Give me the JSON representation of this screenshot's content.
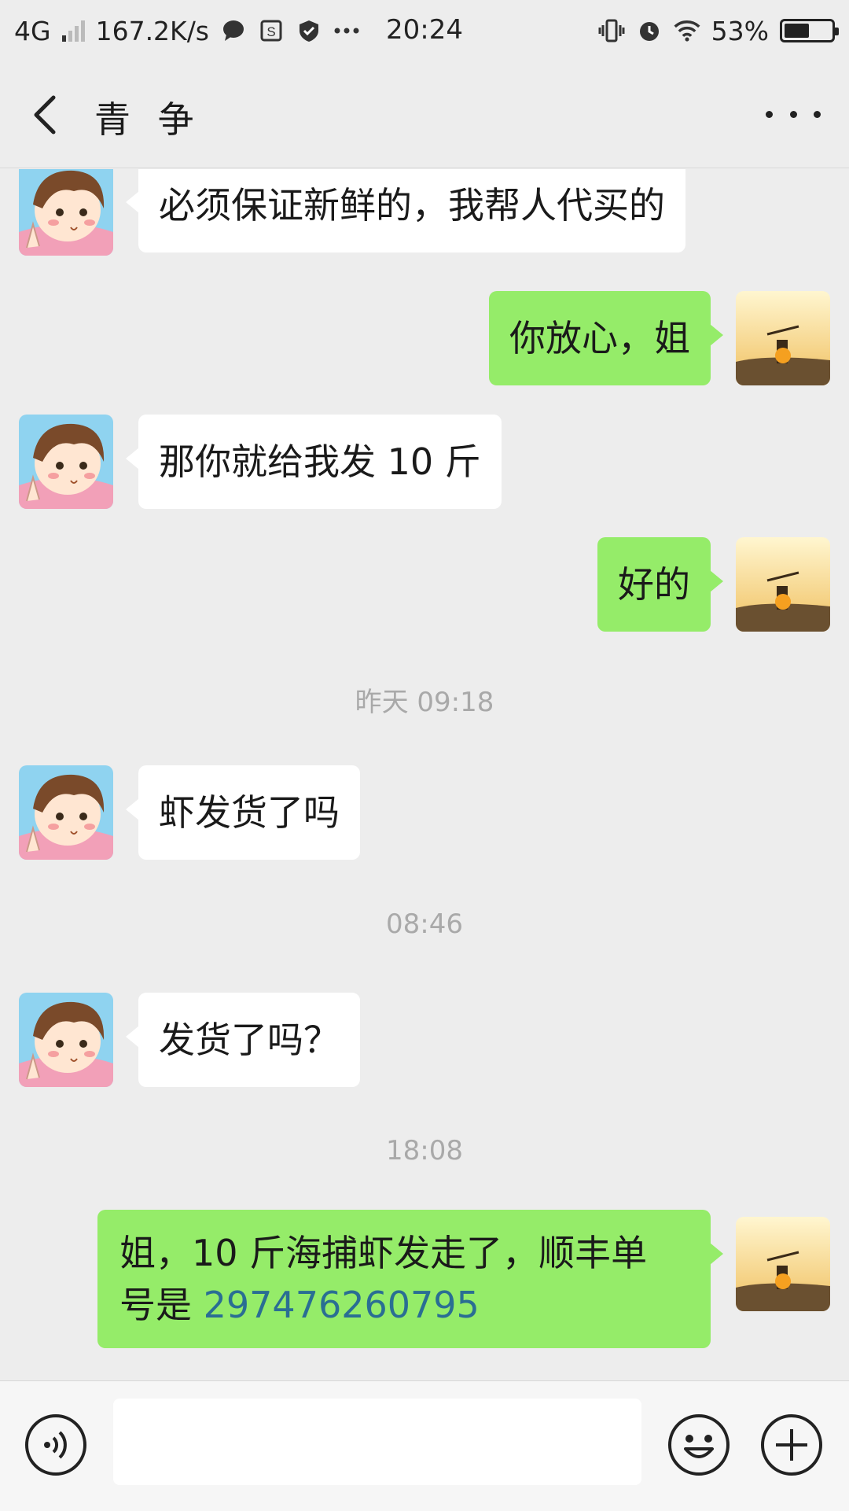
{
  "status_bar": {
    "network": "4G",
    "speed": "167.2K/s",
    "time": "20:24",
    "battery": "53%",
    "battery_level": 0.53,
    "icons": [
      "message-icon",
      "s-app-icon",
      "shield-icon",
      "more-dots-icon",
      "vibrate-icon",
      "alarm-icon",
      "wifi-icon",
      "battery-icon"
    ]
  },
  "header": {
    "title": "青 争",
    "back_icon": "chevron-left-icon",
    "more_icon": "more-horizontal-icon"
  },
  "messages": [
    {
      "side": "in",
      "text": "必须保证新鲜的，我帮人代买的"
    },
    {
      "side": "out",
      "text": "你放心，姐"
    },
    {
      "side": "in",
      "text": "那你就给我发 10 斤"
    },
    {
      "side": "out",
      "text": "好的"
    },
    {
      "timestamp": "昨天 09:18"
    },
    {
      "side": "in",
      "text": "虾发货了吗"
    },
    {
      "timestamp": "08:46"
    },
    {
      "side": "in",
      "text": "发货了吗？"
    },
    {
      "timestamp": "18:08"
    },
    {
      "side": "out",
      "text_prefix": "姐，10 斤海捕虾发走了，顺丰单\n号是 ",
      "tracking_number": "297476260795"
    }
  ],
  "input_bar": {
    "placeholder": "",
    "voice_icon": "voice-icon",
    "emoji_icon": "emoji-icon",
    "plus_icon": "plus-icon"
  },
  "colors": {
    "background": "#ededed",
    "outgoing_bubble": "#95ec69",
    "incoming_bubble": "#ffffff",
    "tracking_link": "#2a6e93",
    "timestamp": "#a9a9a9"
  }
}
